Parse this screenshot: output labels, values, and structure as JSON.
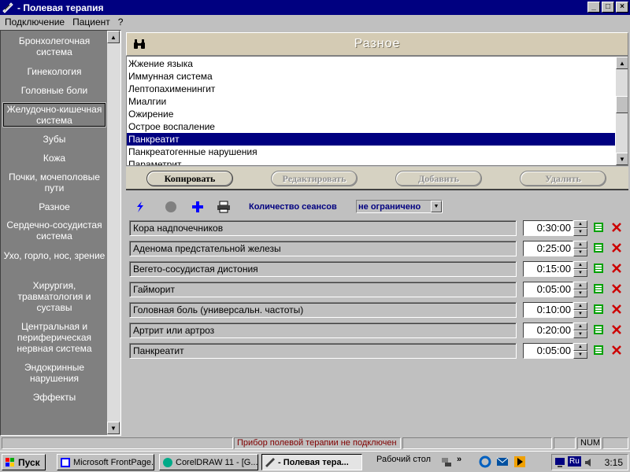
{
  "window": {
    "title": "- Полевая терапия",
    "buttons": {
      "minimize": "_",
      "maximize": "□",
      "close": "×"
    }
  },
  "menu": [
    {
      "label": "Подключение"
    },
    {
      "label": "Пациент"
    },
    {
      "label": "?"
    }
  ],
  "sidebar": {
    "items": [
      {
        "label": "Бронхолегочная система"
      },
      {
        "label": "Гинекология"
      },
      {
        "label": "Головные боли"
      },
      {
        "label": "Желудочно-кишечная система"
      },
      {
        "label": "Зубы"
      },
      {
        "label": "Кожа"
      },
      {
        "label": "Почки, мочеполовые пути"
      },
      {
        "label": "Разное"
      },
      {
        "label": "Сердечно-сосудистая система"
      },
      {
        "label": "Ухо, горло, нос, зрение"
      },
      {
        "label": "Хирургия, травматология и суставы"
      },
      {
        "label": "Центральная и периферическая нервная система"
      },
      {
        "label": "Эндокринные нарушения"
      },
      {
        "label": "Эффекты"
      }
    ],
    "active_index": 3
  },
  "panel": {
    "title": "Разное",
    "list_items": [
      "Жжение языка",
      "Иммунная система",
      "Лептопахименингит",
      "Миалгии",
      "Ожирение",
      "Острое воспаление",
      "Панкреатит",
      "Панкреатогенные нарушения",
      "Параметрит"
    ],
    "selected_index": 6,
    "buttons": {
      "copy": "Копировать",
      "edit": "Редактировать",
      "add": "Добавить",
      "delete": "Удалить"
    }
  },
  "toolbar": {
    "sessions_label": "Количество сеансов",
    "sessions_value": "не ограничено"
  },
  "sessions": [
    {
      "name": "Кора надпочечников",
      "time": "0:30:00"
    },
    {
      "name": "Аденома предстательной железы",
      "time": "0:25:00"
    },
    {
      "name": "Вегето-сосудистая дистония",
      "time": "0:15:00"
    },
    {
      "name": "Гайморит",
      "time": "0:05:00"
    },
    {
      "name": "Головная боль (универсальн. частоты)",
      "time": "0:10:00"
    },
    {
      "name": "Артрит или артроз",
      "time": "0:20:00"
    },
    {
      "name": "Панкреатит",
      "time": "0:05:00"
    }
  ],
  "status": {
    "message": "Прибор полевой терапии не подключен",
    "num": "NUM"
  },
  "taskbar": {
    "start": "Пуск",
    "tasks": [
      {
        "label": "Microsoft FrontPage..."
      },
      {
        "label": "CorelDRAW 11 - [G..."
      },
      {
        "label": "- Полевая тера..."
      }
    ],
    "desktop": "Рабочий стол",
    "lang": "Ru",
    "clock": "3:15"
  },
  "colors": {
    "titlebar": "#000080",
    "selection": "#000080",
    "nav_bg": "#808080",
    "header_bg": "#d4cbb4",
    "delete_icon": "#cc0000",
    "edit_icon": "#00a000"
  }
}
